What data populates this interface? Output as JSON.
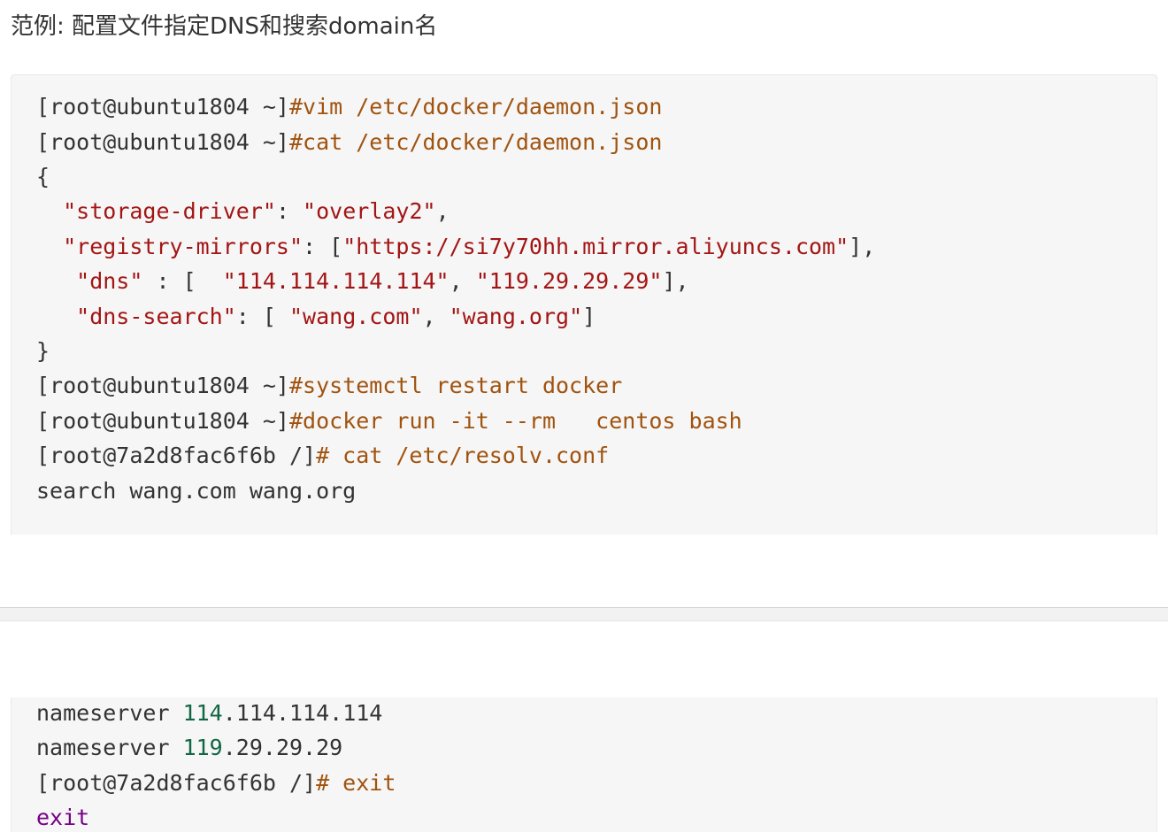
{
  "title": "范例: 配置文件指定DNS和搜索domain名",
  "block1": {
    "l1": {
      "prompt": "[root@ubuntu1804 ~]",
      "cmd": "#vim /etc/docker/daemon.json"
    },
    "l2": {
      "prompt": "[root@ubuntu1804 ~]",
      "cmd": "#cat /etc/docker/daemon.json"
    },
    "l3": "{",
    "l4": {
      "indent": "  ",
      "key": "\"storage-driver\"",
      "sep": ": ",
      "val": "\"overlay2\"",
      "end": ","
    },
    "l5": {
      "indent": "  ",
      "key": "\"registry-mirrors\"",
      "sep": ": [",
      "val": "\"https://si7y70hh.mirror.aliyuncs.com\"",
      "end": "],"
    },
    "l6": {
      "indent": "   ",
      "key": "\"dns\"",
      "sep": " : [  ",
      "v1": "\"114.114.114.114\"",
      "mid": ", ",
      "v2": "\"119.29.29.29\"",
      "end": "],"
    },
    "l7": {
      "indent": "   ",
      "key": "\"dns-search\"",
      "sep": ": [ ",
      "v1": "\"wang.com\"",
      "mid": ", ",
      "v2": "\"wang.org\"",
      "end": "]"
    },
    "l8": "}",
    "l9": {
      "prompt": "[root@ubuntu1804 ~]",
      "cmd": "#systemctl restart docker"
    },
    "l10": {
      "prompt": "[root@ubuntu1804 ~]",
      "cmd": "#docker run -it --rm   centos bash"
    },
    "l11": {
      "prompt": "[root@7a2d8fac6f6b /]",
      "cmd": "# cat /etc/resolv.conf"
    },
    "l12": "search wang.com wang.org"
  },
  "block2": {
    "l1": {
      "word": "nameserver ",
      "num": "114",
      "rest": ".114.114.114"
    },
    "l2": {
      "word": "nameserver ",
      "num": "119",
      "rest": ".29.29.29"
    },
    "l3": {
      "prompt": "[root@7a2d8fac6f6b /]",
      "cmd": "# exit"
    },
    "l4": "exit"
  }
}
